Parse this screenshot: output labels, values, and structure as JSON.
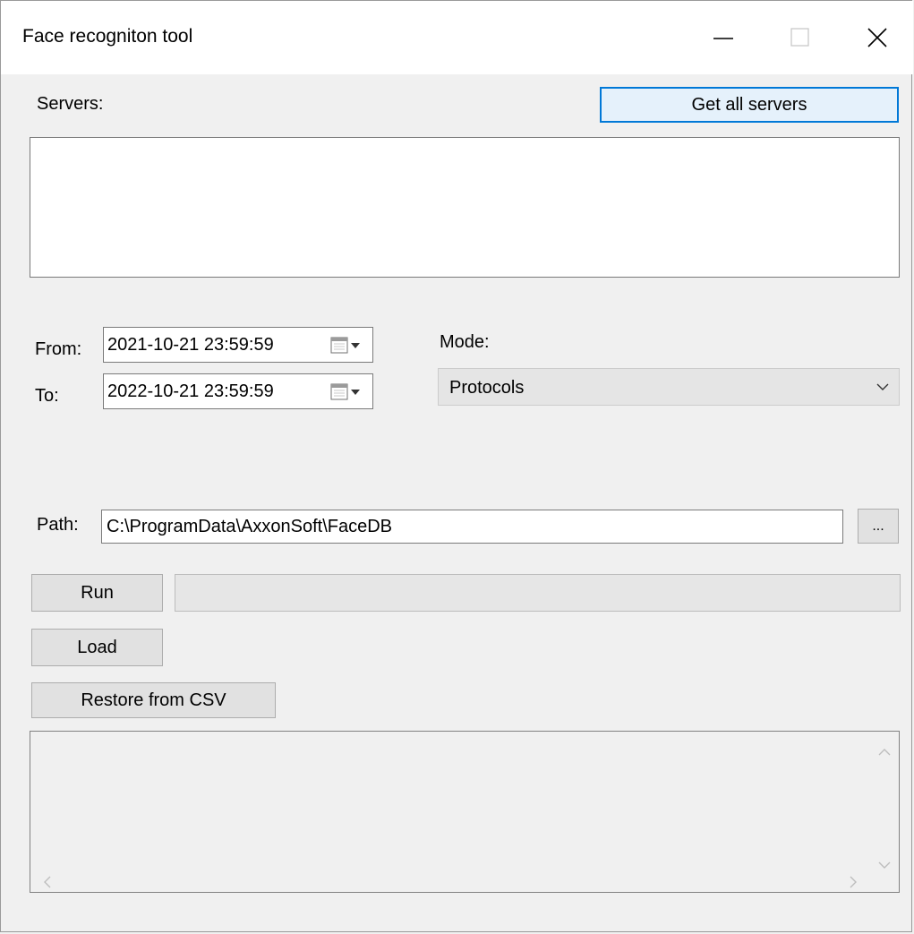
{
  "window": {
    "title": "Face recogniton tool"
  },
  "servers": {
    "label": "Servers:",
    "get_all_button": "Get all servers",
    "items": []
  },
  "range": {
    "from_label": "From:",
    "from_value": "2021-10-21 23:59:59",
    "to_label": "To:",
    "to_value": "2022-10-21 23:59:59"
  },
  "mode": {
    "label": "Mode:",
    "selected": "Protocols"
  },
  "path": {
    "label": "Path:",
    "value": "C:\\ProgramData\\AxxonSoft\\FaceDB",
    "browse_label": "..."
  },
  "actions": {
    "run": "Run",
    "load": "Load",
    "restore": "Restore from CSV",
    "progress_fraction": 0
  },
  "log": {
    "text": ""
  },
  "colors": {
    "focus_border": "#0078d7",
    "button_face": "#e1e1e1",
    "window_bg": "#f0f0f0"
  }
}
